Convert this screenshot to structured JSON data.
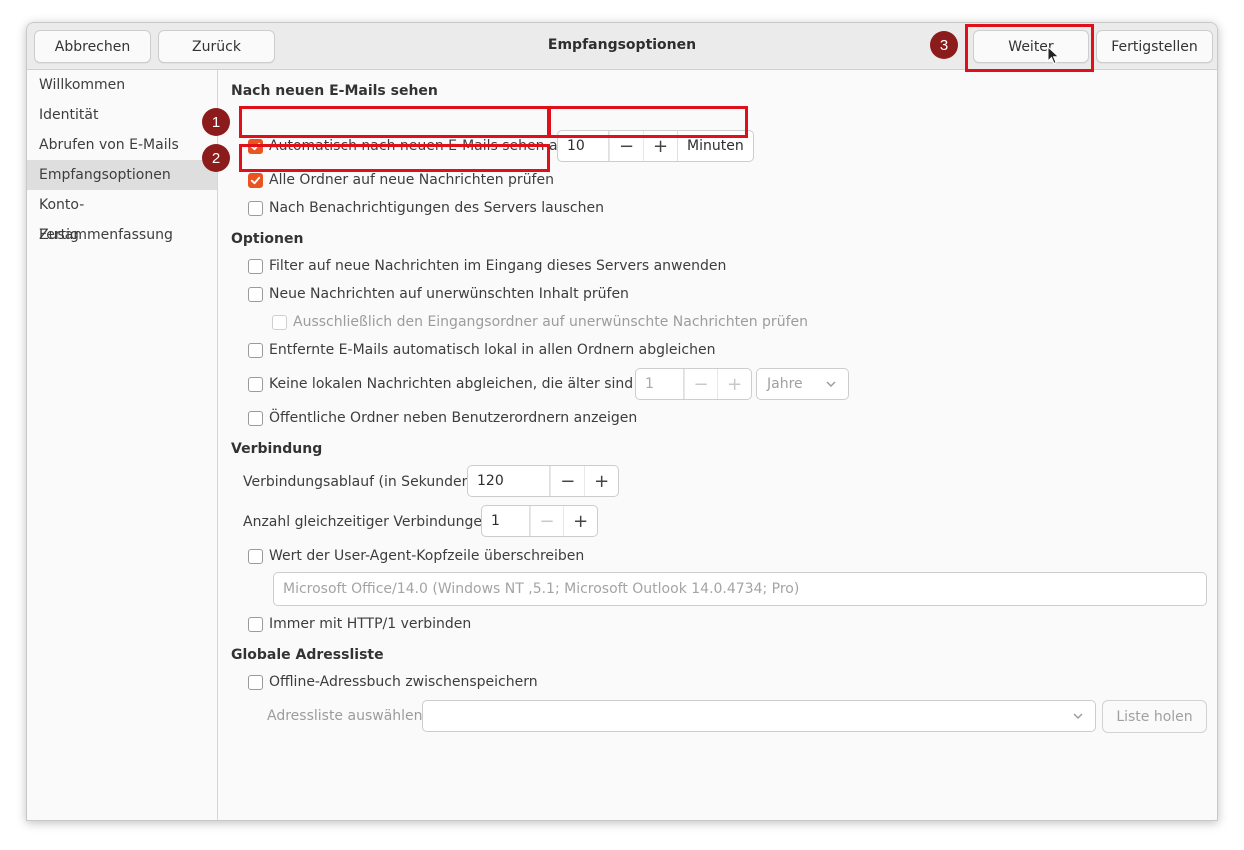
{
  "window": {
    "title": "Empfangsoptionen",
    "buttons": {
      "cancel": "Abbrechen",
      "back": "Zurück",
      "next": "Weiter",
      "finish": "Fertigstellen"
    }
  },
  "sidebar": {
    "items": [
      {
        "label": "Willkommen",
        "selected": false
      },
      {
        "label": "Identität",
        "selected": false
      },
      {
        "label": "Abrufen von E-Mails",
        "selected": false
      },
      {
        "label": "Empfangsoptionen",
        "selected": true
      },
      {
        "label": "Konto-Zusammenfassung",
        "selected": false
      },
      {
        "label": "Fertig",
        "selected": false
      }
    ]
  },
  "check_mail": {
    "heading": "Nach neuen E-Mails sehen",
    "auto_check_label": "Automatisch nach neuen E-Mails sehen alle",
    "auto_check_checked": true,
    "interval_value": "10",
    "interval_unit": "Minuten",
    "all_folders_label": "Alle Ordner auf neue Nachrichten prüfen",
    "all_folders_checked": true,
    "notifications_label": "Nach Benachrichtigungen des Servers lauschen",
    "notifications_checked": false
  },
  "options": {
    "heading": "Optionen",
    "filter_label": "Filter auf neue Nachrichten im Eingang dieses Servers anwenden",
    "junk_label": "Neue Nachrichten auf unerwünschten Inhalt prüfen",
    "junk_inbox_label": "Ausschließlich den Eingangsordner auf unerwünschte Nachrichten prüfen",
    "sync_label": "Entfernte E-Mails automatisch lokal in allen Ordnern abgleichen",
    "no_sync_label": "Keine lokalen Nachrichten abgleichen, die älter sind als",
    "no_sync_value": "1",
    "no_sync_unit": "Jahre",
    "public_folders_label": "Öffentliche Ordner neben Benutzerordnern anzeigen"
  },
  "connection": {
    "heading": "Verbindung",
    "timeout_label": "Verbindungsablauf (in Sekunden)",
    "timeout_value": "120",
    "concurrent_label": "Anzahl gleichzeitiger Verbindungen",
    "concurrent_value": "1",
    "user_agent_label": "Wert der User-Agent-Kopfzeile überschreiben",
    "user_agent_placeholder": "Microsoft Office/14.0 (Windows NT ,5.1; Microsoft Outlook 14.0.4734; Pro)",
    "http1_label": "Immer mit HTTP/1 verbinden"
  },
  "gal": {
    "heading": "Globale Adressliste",
    "offline_label": "Offline-Adressbuch zwischenspeichern",
    "select_label": "Adressliste auswählen:",
    "fetch_button": "Liste holen"
  },
  "annotations": {
    "badge_1": "1",
    "badge_2": "2",
    "badge_3": "3",
    "color": "#e0101a",
    "badge_color": "#8c1b1b"
  },
  "accent_color": "#e95420"
}
